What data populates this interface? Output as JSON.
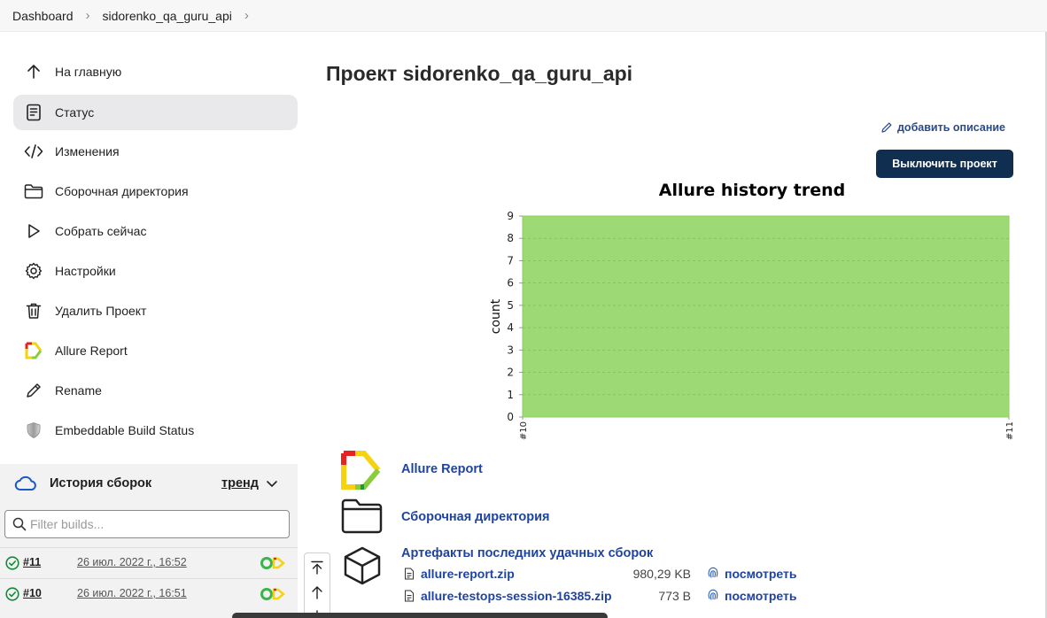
{
  "breadcrumb": {
    "items": [
      "Dashboard",
      "sidorenko_qa_guru_api"
    ]
  },
  "sidebar": {
    "items": [
      {
        "label": "На главную",
        "icon": "arrow-up-icon"
      },
      {
        "label": "Статус",
        "icon": "document-icon",
        "active": true
      },
      {
        "label": "Изменения",
        "icon": "code-icon"
      },
      {
        "label": "Сборочная директория",
        "icon": "folder-icon"
      },
      {
        "label": "Собрать сейчас",
        "icon": "play-icon"
      },
      {
        "label": "Настройки",
        "icon": "gear-icon"
      },
      {
        "label": "Удалить Проект",
        "icon": "trash-icon"
      },
      {
        "label": "Allure Report",
        "icon": "allure-icon"
      },
      {
        "label": "Rename",
        "icon": "pencil-icon"
      },
      {
        "label": "Embeddable Build Status",
        "icon": "shield-icon"
      }
    ]
  },
  "history": {
    "title": "История сборок",
    "trend_label": "тренд",
    "filter_placeholder": "Filter builds...",
    "builds": [
      {
        "number": "#11",
        "date": "26 июл. 2022 г., 16:52"
      },
      {
        "number": "#10",
        "date": "26 июл. 2022 г., 16:51"
      }
    ]
  },
  "main": {
    "title": "Проект sidorenko_qa_guru_api",
    "add_description": "добавить описание",
    "disable_button": "Выключить проект",
    "links": {
      "allure": "Allure Report",
      "workspace": "Сборочная директория",
      "artifacts_title": "Артефакты последних удачных сборок"
    },
    "artifacts": [
      {
        "name": "allure-report.zip",
        "size": "980,29 KB",
        "view": "посмотреть"
      },
      {
        "name": "allure-testops-session-16385.zip",
        "size": "773 B",
        "view": "посмотреть"
      }
    ]
  },
  "chart_data": {
    "type": "area",
    "title": "Allure history trend",
    "ylabel": "count",
    "xlabel": "",
    "x": [
      "#10",
      "#11"
    ],
    "series": [
      {
        "values": [
          9,
          9
        ]
      }
    ],
    "ylim": [
      0,
      9
    ],
    "yticks": [
      0,
      1,
      2,
      3,
      4,
      5,
      6,
      7,
      8,
      9
    ],
    "grid": true,
    "colors": {
      "fill": "#9dda75",
      "grid": "#6aa84f"
    }
  }
}
